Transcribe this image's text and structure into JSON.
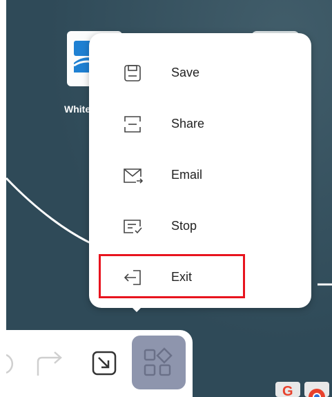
{
  "desktop": {
    "app_label": "White"
  },
  "menu": {
    "items": [
      {
        "label": "Save",
        "icon": "save-icon"
      },
      {
        "label": "Share",
        "icon": "share-icon"
      },
      {
        "label": "Email",
        "icon": "email-icon"
      },
      {
        "label": "Stop",
        "icon": "stop-icon"
      },
      {
        "label": "Exit",
        "icon": "exit-icon"
      }
    ],
    "highlighted_item": "Exit"
  },
  "toolbar": {
    "tools": [
      "undo-icon",
      "redo-icon",
      "resize-icon",
      "apps-grid-icon"
    ],
    "active_tool": "apps-grid-icon"
  },
  "colors": {
    "background": "#2f4a58",
    "highlight_border": "#e8141e",
    "active_tool": "#8e95ad"
  }
}
